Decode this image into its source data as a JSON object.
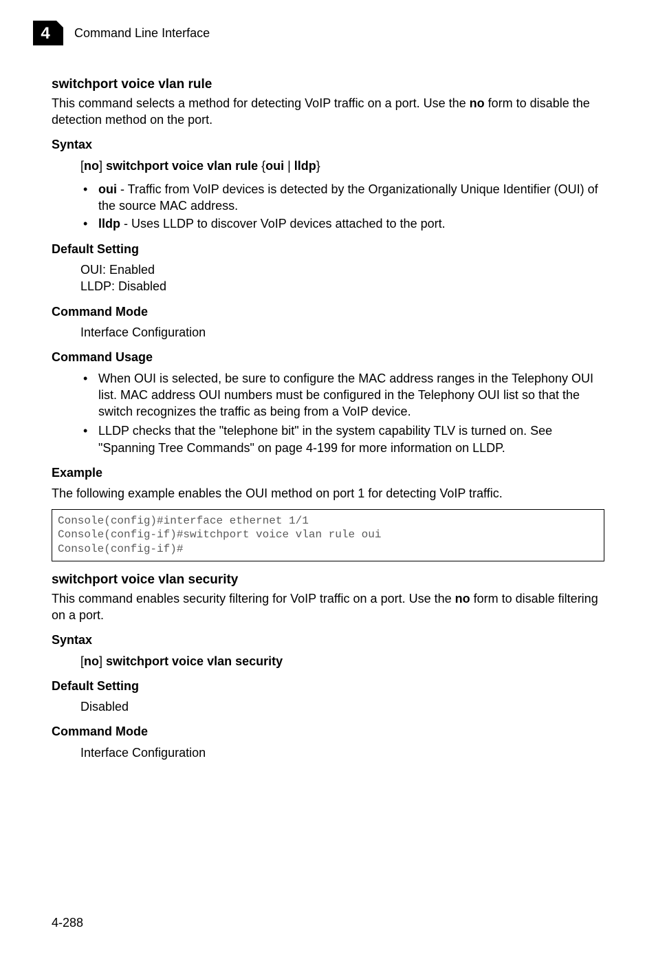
{
  "header": {
    "text": "Command Line Interface",
    "tab_number": "4"
  },
  "section1": {
    "title": "switchport voice vlan rule",
    "intro_pre": "This command selects a method for detecting VoIP traffic on a port. Use the ",
    "intro_bold": "no",
    "intro_post": " form to disable the detection method on the port.",
    "syntax_h": "Syntax",
    "syntax_line": {
      "p1": "[",
      "p2": "no",
      "p3": "] ",
      "p4": "switchport voice vlan rule",
      "p5": " {",
      "p6": "oui",
      "p7": " | ",
      "p8": "lldp",
      "p9": "}"
    },
    "syntax_bullets": [
      {
        "b": "oui",
        "rest": " - Traffic from VoIP devices is detected by the Organizationally Unique Identifier (OUI) of the source MAC address."
      },
      {
        "b": "lldp",
        "rest": " - Uses LLDP to discover VoIP devices attached to the port."
      }
    ],
    "default_h": "Default Setting",
    "default_l1": "OUI: Enabled",
    "default_l2": "LLDP: Disabled",
    "mode_h": "Command Mode",
    "mode_v": "Interface Configuration",
    "usage_h": "Command Usage",
    "usage_bullets": [
      "When OUI is selected, be sure to configure the MAC address ranges in the Telephony OUI list. MAC address OUI numbers must be configured in the Telephony OUI list so that the switch recognizes the traffic as being from a VoIP device.",
      "LLDP checks that the \"telephone bit\" in the system capability TLV is turned on. See \"Spanning Tree Commands\" on page 4-199 for more information on LLDP."
    ],
    "example_h": "Example",
    "example_intro": "The following example enables the OUI method on port 1 for detecting VoIP traffic.",
    "code": "Console(config)#interface ethernet 1/1\nConsole(config-if)#switchport voice vlan rule oui\nConsole(config-if)#"
  },
  "section2": {
    "title": "switchport voice vlan security",
    "intro_pre": "This command enables security filtering for VoIP traffic on a port. Use the ",
    "intro_bold": "no",
    "intro_post": " form to disable filtering on a port.",
    "syntax_h": "Syntax",
    "syntax_line": {
      "p1": "[",
      "p2": "no",
      "p3": "] ",
      "p4": "switchport voice vlan security"
    },
    "default_h": "Default Setting",
    "default_v": "Disabled",
    "mode_h": "Command Mode",
    "mode_v": "Interface Configuration"
  },
  "page_number": "4-288"
}
